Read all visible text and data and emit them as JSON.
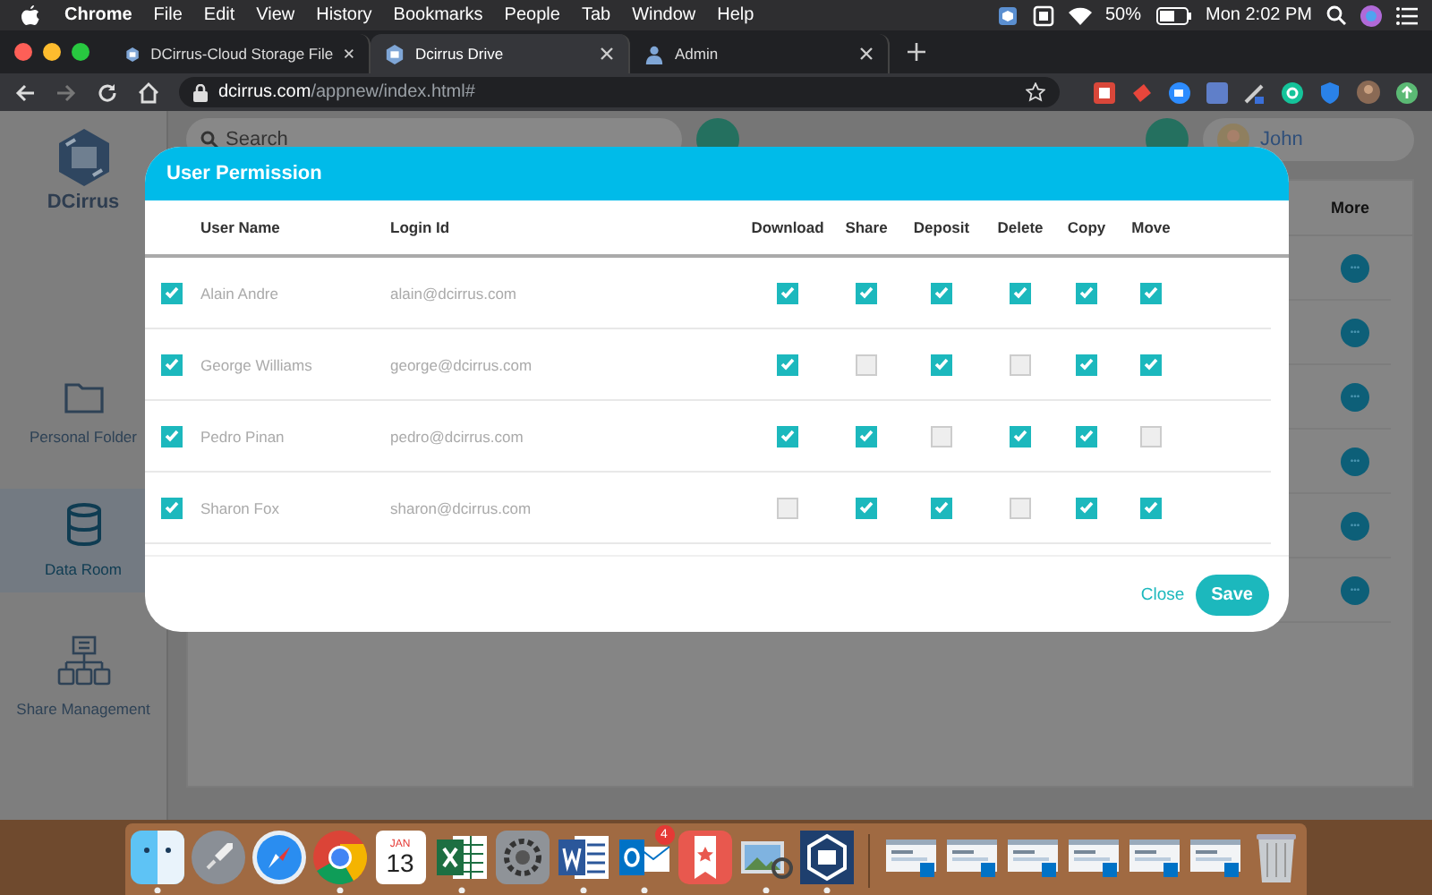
{
  "menu_bar": {
    "app": "Chrome",
    "items": [
      "File",
      "Edit",
      "View",
      "History",
      "Bookmarks",
      "People",
      "Tab",
      "Window",
      "Help"
    ],
    "battery": "50%",
    "clock": "Mon 2:02 PM"
  },
  "browser_tabs": [
    {
      "title": "DCirrus-Cloud Storage File",
      "selected": false
    },
    {
      "title": "Dcirrus Drive",
      "selected": true
    },
    {
      "title": "Admin",
      "selected": false
    }
  ],
  "address_bar": {
    "host": "dcirrus.com",
    "path": "/appnew/index.html#"
  },
  "sidebar": {
    "brand": "DCirrus",
    "items": [
      {
        "label": "Personal Folder",
        "selected": false
      },
      {
        "label": "Data Room",
        "selected": true
      },
      {
        "label": "Share Management",
        "selected": false
      }
    ]
  },
  "top_bar": {
    "search": {
      "placeholder": "Search"
    },
    "user": "John"
  },
  "file_table": {
    "column": "More",
    "rows": [
      {
        "menu": "•••"
      },
      {
        "menu": "•••"
      },
      {
        "menu": "•••"
      },
      {
        "menu": "•••"
      },
      {
        "menu": "•••"
      },
      {
        "menu": "•••"
      }
    ]
  },
  "dialog": {
    "title": "User Permission",
    "columns": [
      "User Name",
      "Login Id",
      "Download",
      "Share",
      "Deposit",
      "Delete",
      "Copy",
      "Move"
    ],
    "rows": [
      {
        "checked": true,
        "name": "Alain Andre",
        "login": "alain@dcirrus.com",
        "permissions": [
          {
            "checked": true
          },
          {
            "checked": true
          },
          {
            "checked": true
          },
          {
            "checked": true
          },
          {
            "checked": true
          },
          {
            "checked": true
          }
        ]
      },
      {
        "checked": true,
        "name": "George Williams",
        "login": "george@dcirrus.com",
        "permissions": [
          {
            "checked": true
          },
          {
            "checked": false
          },
          {
            "checked": true
          },
          {
            "checked": false
          },
          {
            "checked": true
          },
          {
            "checked": true
          }
        ]
      },
      {
        "checked": true,
        "name": "Pedro Pinan",
        "login": "pedro@dcirrus.com",
        "permissions": [
          {
            "checked": true
          },
          {
            "checked": true
          },
          {
            "checked": false
          },
          {
            "checked": true
          },
          {
            "checked": true
          },
          {
            "checked": false
          }
        ]
      },
      {
        "checked": true,
        "name": "Sharon Fox",
        "login": "sharon@dcirrus.com",
        "permissions": [
          {
            "checked": false
          },
          {
            "checked": true
          },
          {
            "checked": true
          },
          {
            "checked": false
          },
          {
            "checked": true
          },
          {
            "checked": true
          }
        ]
      }
    ],
    "close": "Close",
    "save": "Save"
  },
  "dock": {
    "items": [
      {
        "kind": "finder",
        "running": true
      },
      {
        "kind": "launchpad",
        "running": false
      },
      {
        "kind": "safari",
        "running": false
      },
      {
        "kind": "chrome",
        "running": true
      },
      {
        "kind": "calendar",
        "running": false,
        "month": "JAN",
        "day": "13"
      },
      {
        "kind": "excel",
        "running": true
      },
      {
        "kind": "settings",
        "running": false
      },
      {
        "kind": "word",
        "running": true
      },
      {
        "kind": "outlook",
        "running": true,
        "badge": "4"
      },
      {
        "kind": "wunderlist",
        "running": false
      },
      {
        "kind": "preview",
        "running": true
      },
      {
        "kind": "dcirrus",
        "running": true
      },
      {
        "kind": "separator"
      },
      {
        "kind": "window"
      },
      {
        "kind": "window"
      },
      {
        "kind": "window"
      },
      {
        "kind": "window"
      },
      {
        "kind": "window"
      },
      {
        "kind": "window"
      },
      {
        "kind": "trash"
      }
    ]
  }
}
